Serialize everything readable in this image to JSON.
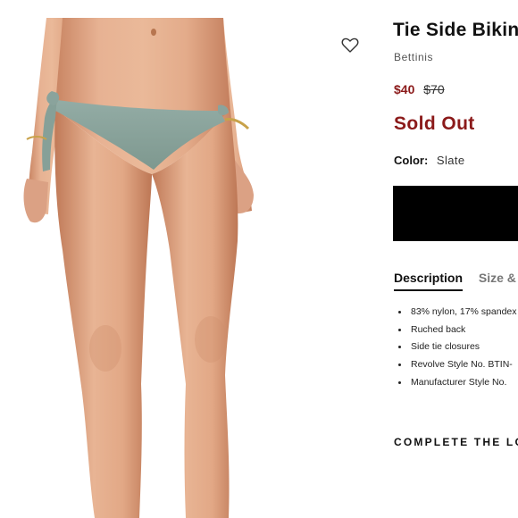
{
  "product": {
    "title": "Tie Side Bikini",
    "brand": "Bettinis",
    "price_sale": "$40",
    "price_original": "$70",
    "status": "Sold Out",
    "color_label": "Color:",
    "color_value": "Slate"
  },
  "tabs": [
    {
      "label": "Description",
      "active": true
    },
    {
      "label": "Size & Fit",
      "active": false
    }
  ],
  "description_items": [
    "83% nylon, 17% spandex",
    "Ruched back",
    "Side tie closures",
    "Revolve Style No. BTIN-",
    "Manufacturer Style No."
  ],
  "section_heading": "COMPLETE THE LOOK",
  "colors": {
    "sale_price": "#8b1a1a",
    "sold_out": "#8b1a1a",
    "bikini": "#8aa39c",
    "skin": "#e0a98a"
  },
  "icons": {
    "wishlist": "heart-outline-icon"
  }
}
